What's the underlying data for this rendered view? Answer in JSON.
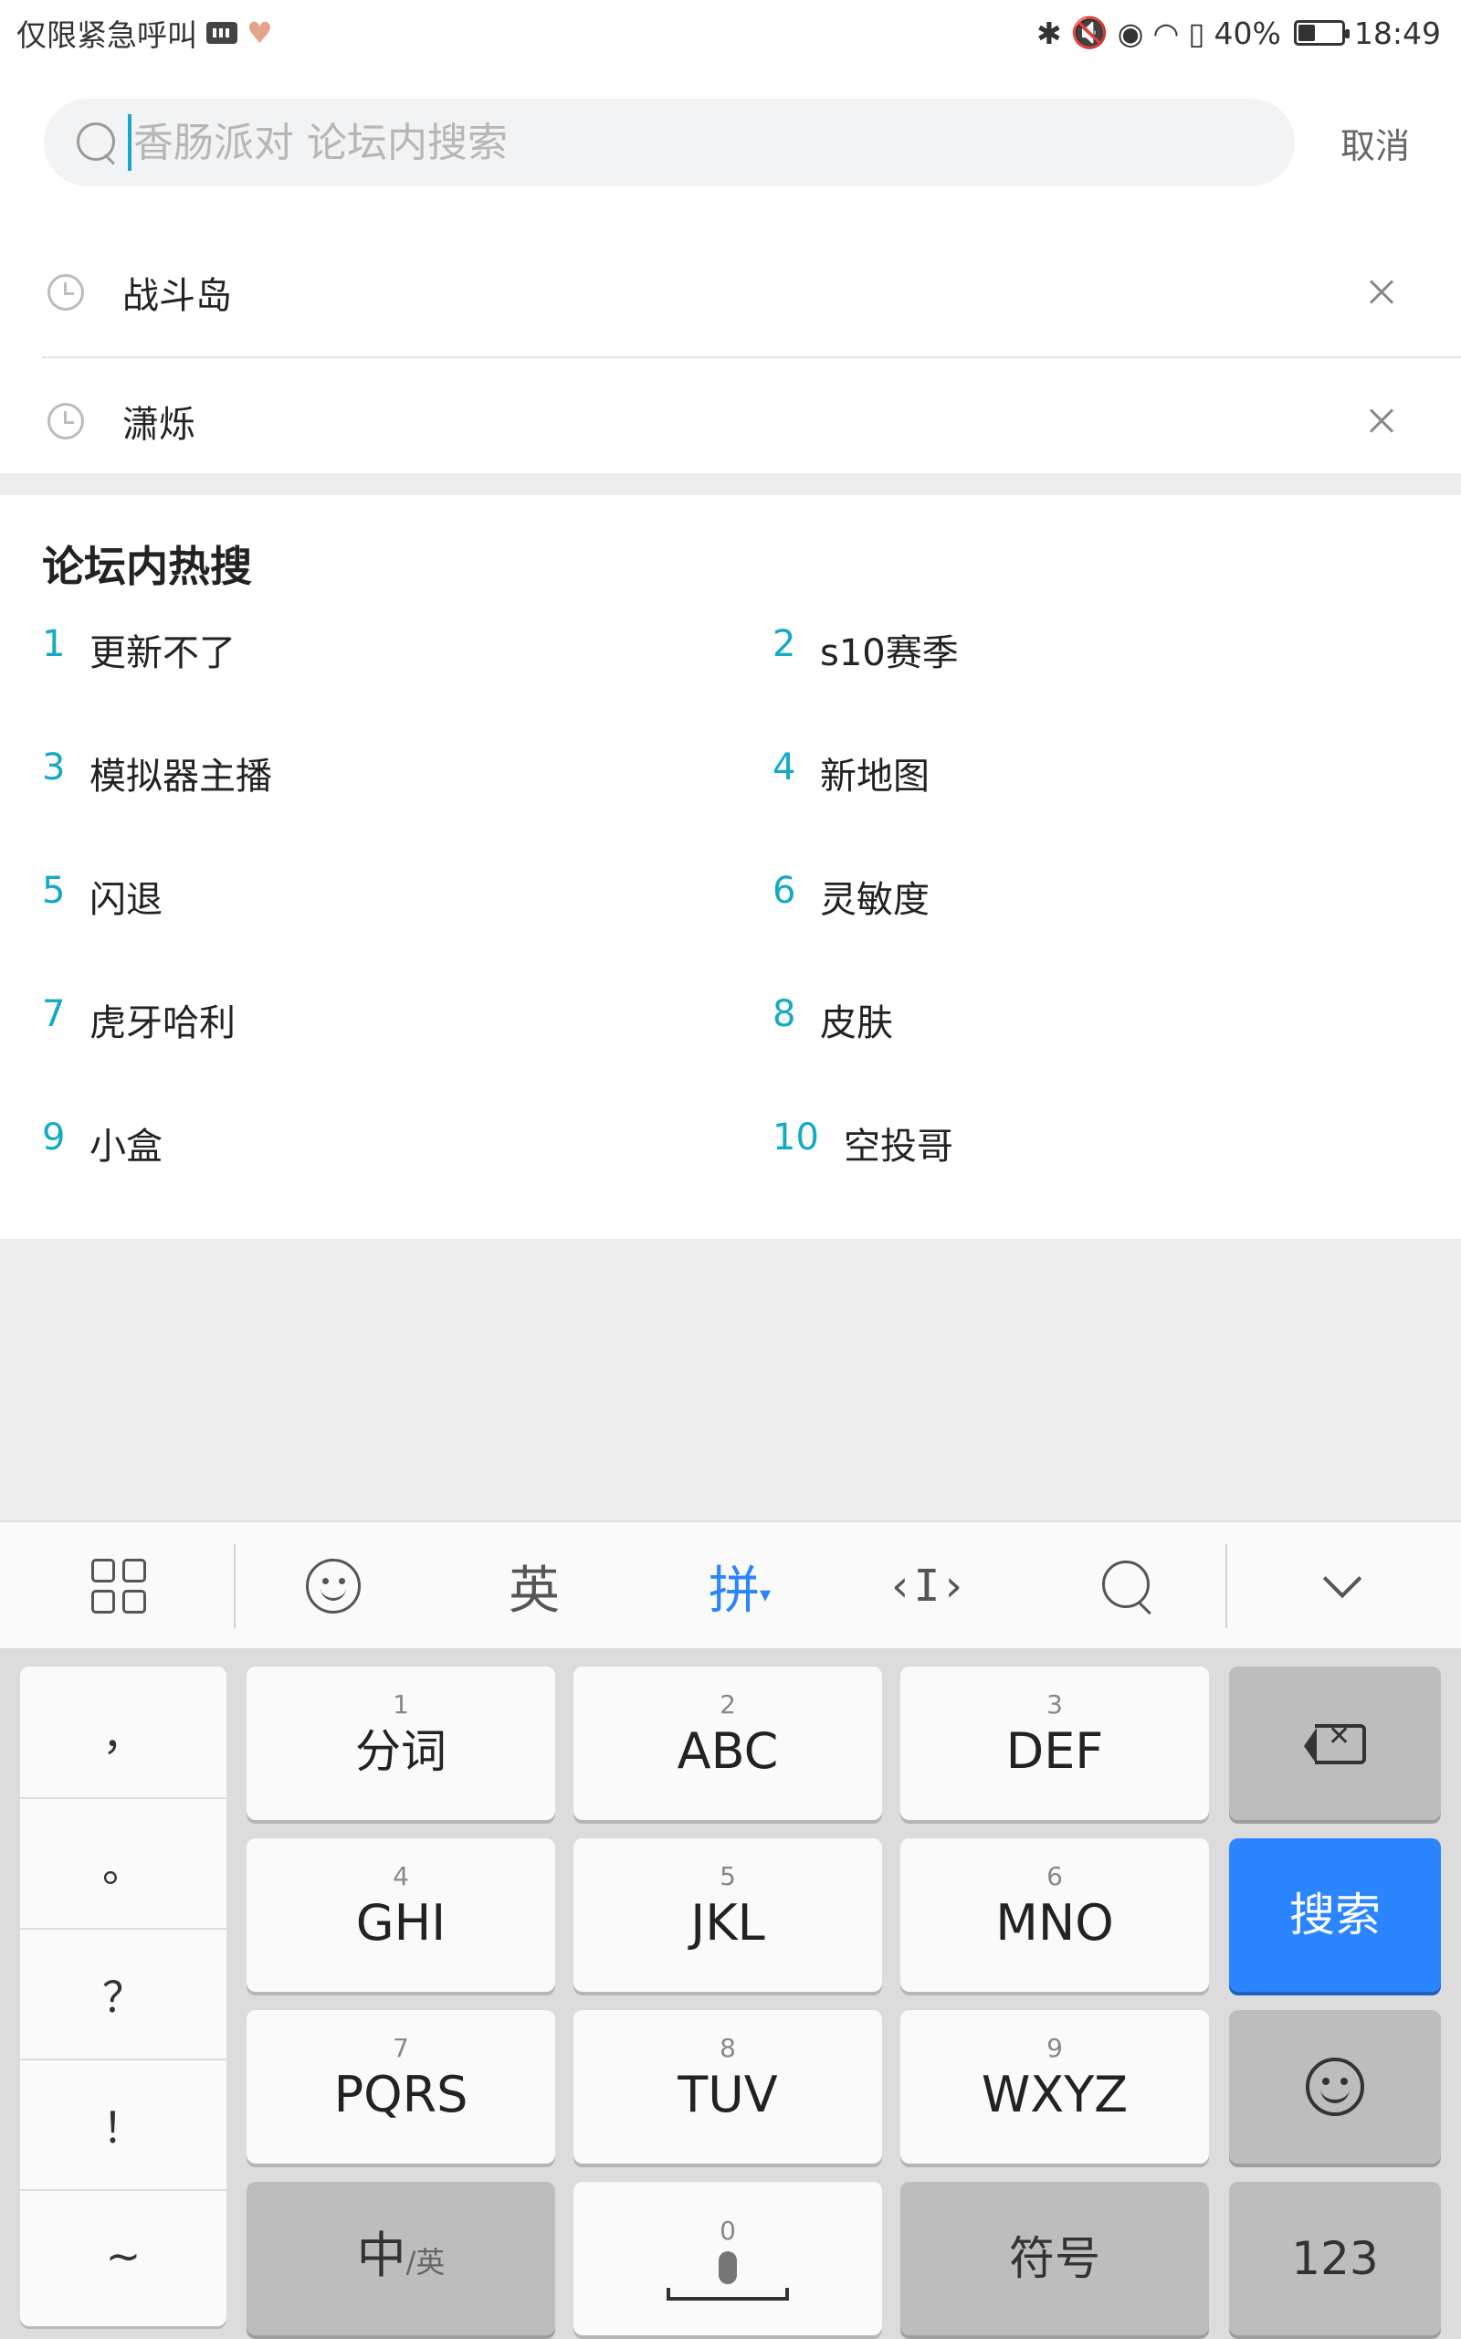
{
  "status_bar": {
    "left_text": "仅限紧急呼叫",
    "battery_percent": "40%",
    "battery_level": 0.4,
    "time": "18:49",
    "icons": [
      "keyboard-icon",
      "health-heart-icon",
      "bluetooth-icon",
      "mute-icon",
      "eye-comfort-icon",
      "wifi-icon",
      "battery-alert-icon",
      "battery-icon"
    ]
  },
  "search": {
    "placeholder": "香肠派对 论坛内搜索",
    "value": "",
    "cancel_label": "取消"
  },
  "history": [
    {
      "label": "战斗岛"
    },
    {
      "label": "潇烁"
    }
  ],
  "hot_search": {
    "title": "论坛内热搜",
    "items": [
      {
        "rank": "1",
        "label": "更新不了"
      },
      {
        "rank": "2",
        "label": "s10赛季"
      },
      {
        "rank": "3",
        "label": "模拟器主播"
      },
      {
        "rank": "4",
        "label": "新地图"
      },
      {
        "rank": "5",
        "label": "闪退"
      },
      {
        "rank": "6",
        "label": "灵敏度"
      },
      {
        "rank": "7",
        "label": "虎牙哈利"
      },
      {
        "rank": "8",
        "label": "皮肤"
      },
      {
        "rank": "9",
        "label": "小盒"
      },
      {
        "rank": "10",
        "label": "空投哥"
      }
    ]
  },
  "keyboard": {
    "toolbar": {
      "english_label": "英",
      "pinyin_label": "拼",
      "pinyin_arrow": "▾",
      "cursor_label": "‹I›"
    },
    "punctuation": [
      "，",
      "。",
      "？",
      "！",
      "~"
    ],
    "keys": {
      "k1": {
        "num": "1",
        "label": "分词"
      },
      "k2": {
        "num": "2",
        "label": "ABC"
      },
      "k3": {
        "num": "3",
        "label": "DEF"
      },
      "k4": {
        "num": "4",
        "label": "GHI"
      },
      "k5": {
        "num": "5",
        "label": "JKL"
      },
      "k6": {
        "num": "6",
        "label": "MNO"
      },
      "k7": {
        "num": "7",
        "label": "PQRS"
      },
      "k8": {
        "num": "8",
        "label": "TUV"
      },
      "k9": {
        "num": "9",
        "label": "WXYZ"
      },
      "k0": {
        "num": "0"
      }
    },
    "search_key_label": "搜索",
    "lang_key_main": "中",
    "lang_key_sub": "/英",
    "symbol_key_label": "符号",
    "numeric_key_label": "123"
  },
  "colors": {
    "accent": "#14a9c4",
    "keyboard_blue": "#2a85ff",
    "background_grey": "#eeeeee"
  }
}
